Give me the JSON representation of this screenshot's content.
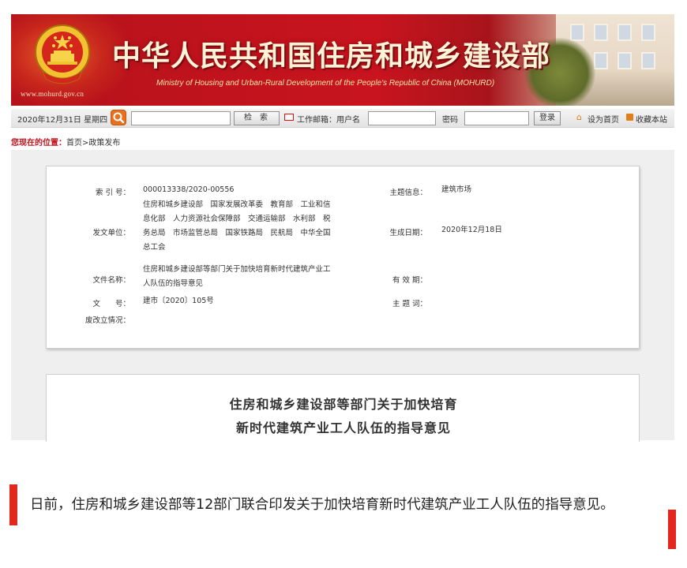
{
  "banner": {
    "title": "中华人民共和国住房和城乡建设部",
    "subtitle": "Ministry of Housing and Urban-Rural Development of the People's Republic of China (MOHURD)",
    "url": "www.mohurd.gov.cn",
    "emblem_icon": "national-emblem-icon"
  },
  "toolbar": {
    "date": "2020年12月31日 星期四",
    "search_button": "检索",
    "mail_label": "工作邮箱：用户名",
    "password_label": "密码",
    "login_button": "登录",
    "home_link": "设为首页",
    "favorite_link": "收藏本站"
  },
  "breadcrumb": {
    "here": "您现在的位置：",
    "path": "首页>政策发布"
  },
  "info": {
    "index_label": "索 引 号：",
    "index_value": "000013338/2020-00556",
    "topic_label": "主题信息：",
    "topic_value": "建筑市场",
    "issuer_label": "发文单位：",
    "issuer_lines": [
      "住房和城乡建设部　国家发展改革委　教育部　工业和信",
      "息化部　人力资源社会保障部　交通运输部　水利部　税",
      "务总局　市场监管总局　国家铁路局　民航局　中华全国",
      "总工会"
    ],
    "date_label": "生成日期：",
    "date_value": "2020年12月18日",
    "filename_label": "文件名称：",
    "filename_lines": [
      "住房和城乡建设部等部门关于加快培育新时代建筑产业工",
      "人队伍的指导意见"
    ],
    "valid_label": "有 效 期：",
    "docno_label": "文　　号：",
    "docno_value": "建市〔2020〕105号",
    "keywords_label": "主 题 词：",
    "status_label": "废改立情况："
  },
  "document": {
    "title_line1": "住房和城乡建设部等部门关于加快培育",
    "title_line2": "新时代建筑产业工人队伍的指导意见"
  },
  "article": {
    "text": "日前，住房和城乡建设部等12部门联合印发关于加快培育新时代建筑产业工人队伍的指导意见。"
  },
  "colors": {
    "brand_red": "#c8141e",
    "accent_bar": "#e2271c",
    "toolbar_orange": "#e8701d"
  }
}
